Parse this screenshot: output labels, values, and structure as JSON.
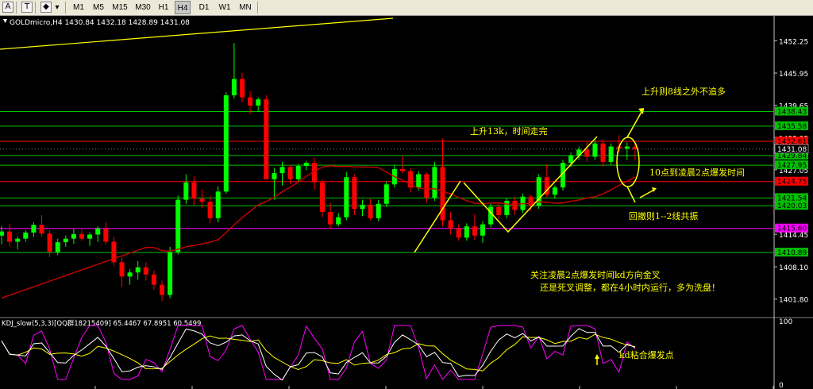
{
  "toolbar": {
    "buttons": [
      "M1",
      "M5",
      "M15",
      "M30",
      "H1",
      "H4",
      "D1",
      "W1",
      "MN"
    ],
    "active": "H4",
    "icons": [
      "cursor-icon",
      "text-icon",
      "shapes-icon"
    ],
    "icon_glyphs": [
      "A",
      "T",
      "◆"
    ]
  },
  "symbol_header": "GOLDmicro,H4  1430.84 1432.18 1428.89 1431.08",
  "indicator_header": "KDJ_slow(5,3,3)[QQ群18215409] 65.4467 67.8951 60.5499",
  "colors": {
    "bull": "#00ff00",
    "bear": "#ff0000",
    "ma": "#cc0000",
    "level_green": "#00c000",
    "level_red": "#ff0000",
    "level_magenta": "#ff00ff",
    "annotation": "#ffff00",
    "k_line": "#ffffff",
    "d_line": "#ffff00",
    "j_line": "#ff00ff"
  },
  "chart_data": {
    "type": "candlestick",
    "symbol": "GOLDmicro",
    "timeframe": "H4",
    "ylim": [
      1398.5,
      1456.5
    ],
    "y_ticks": [
      "1452.25",
      "1445.95",
      "1439.65",
      "1433.35",
      "1427.05",
      "1420.75",
      "1414.45",
      "1408.10",
      "1401.80"
    ],
    "price_levels": [
      {
        "price": 1438.43,
        "label": "1438.43",
        "color": "green"
      },
      {
        "price": 1435.58,
        "label": "1435.58",
        "color": "green"
      },
      {
        "price": 1432.61,
        "label": "1432.61",
        "color": "red"
      },
      {
        "price": 1429.84,
        "label": "1429.84",
        "color": "green"
      },
      {
        "price": 1427.95,
        "label": "1427.95",
        "color": "green"
      },
      {
        "price": 1424.75,
        "label": "1424.75",
        "color": "red"
      },
      {
        "price": 1421.54,
        "label": "1421.54",
        "color": "green"
      },
      {
        "price": 1420.03,
        "label": "1420.03",
        "color": "green"
      },
      {
        "price": 1415.6,
        "label": "1415.60",
        "color": "magenta"
      },
      {
        "price": 1410.89,
        "label": "1410.89",
        "color": "green"
      }
    ],
    "current_price": {
      "price": 1431.08,
      "label": "1431.08"
    },
    "candles": [
      [
        1414.2,
        1416.0,
        1412.5,
        1415.0
      ],
      [
        1415.0,
        1416.5,
        1412.0,
        1413.0
      ],
      [
        1413.0,
        1414.0,
        1411.5,
        1413.6
      ],
      [
        1413.6,
        1415.2,
        1413.0,
        1414.8
      ],
      [
        1414.8,
        1416.8,
        1414.0,
        1416.3
      ],
      [
        1416.3,
        1418.2,
        1414.0,
        1414.6
      ],
      [
        1414.6,
        1415.2,
        1410.0,
        1411.0
      ],
      [
        1411.0,
        1413.6,
        1410.4,
        1412.9
      ],
      [
        1412.9,
        1414.2,
        1412.0,
        1413.6
      ],
      [
        1413.6,
        1415.5,
        1412.6,
        1414.5
      ],
      [
        1414.5,
        1415.4,
        1413.2,
        1413.6
      ],
      [
        1413.6,
        1414.8,
        1412.2,
        1414.4
      ],
      [
        1414.4,
        1416.0,
        1413.0,
        1415.6
      ],
      [
        1415.6,
        1416.8,
        1412.4,
        1413.0
      ],
      [
        1413.0,
        1414.0,
        1408.2,
        1409.0
      ],
      [
        1409.0,
        1410.0,
        1404.2,
        1406.2
      ],
      [
        1406.2,
        1407.6,
        1404.6,
        1407.0
      ],
      [
        1407.0,
        1409.2,
        1405.6,
        1408.0
      ],
      [
        1408.0,
        1409.0,
        1405.4,
        1406.6
      ],
      [
        1406.6,
        1407.4,
        1403.6,
        1404.6
      ],
      [
        1404.6,
        1405.4,
        1401.4,
        1402.6
      ],
      [
        1402.6,
        1412.0,
        1402.0,
        1411.0
      ],
      [
        1411.0,
        1422.0,
        1410.5,
        1421.2
      ],
      [
        1421.2,
        1426.2,
        1420.4,
        1424.6
      ],
      [
        1424.6,
        1425.8,
        1420.2,
        1421.4
      ],
      [
        1421.4,
        1423.2,
        1419.6,
        1420.8
      ],
      [
        1420.8,
        1422.0,
        1416.6,
        1417.6
      ],
      [
        1417.6,
        1423.8,
        1416.8,
        1422.8
      ],
      [
        1422.8,
        1442.2,
        1422.4,
        1441.6
      ],
      [
        1441.6,
        1451.8,
        1441.0,
        1444.8
      ],
      [
        1444.8,
        1446.0,
        1440.2,
        1441.2
      ],
      [
        1441.2,
        1442.4,
        1438.0,
        1439.6
      ],
      [
        1439.6,
        1441.2,
        1438.4,
        1440.8
      ],
      [
        1440.8,
        1441.6,
        1434.6,
        1425.2
      ],
      [
        1425.2,
        1427.4,
        1421.2,
        1426.4
      ],
      [
        1426.4,
        1428.6,
        1424.0,
        1427.6
      ],
      [
        1427.6,
        1428.0,
        1424.2,
        1425.2
      ],
      [
        1425.2,
        1428.2,
        1424.6,
        1427.8
      ],
      [
        1427.8,
        1428.8,
        1427.0,
        1428.4
      ],
      [
        1428.4,
        1429.4,
        1423.2,
        1424.6
      ],
      [
        1424.6,
        1425.2,
        1417.8,
        1418.8
      ],
      [
        1418.8,
        1420.6,
        1415.6,
        1416.4
      ],
      [
        1416.4,
        1418.6,
        1416.0,
        1417.8
      ],
      [
        1417.8,
        1426.6,
        1417.2,
        1425.6
      ],
      [
        1425.6,
        1426.2,
        1418.2,
        1419.4
      ],
      [
        1419.4,
        1421.2,
        1418.0,
        1420.2
      ],
      [
        1420.2,
        1421.4,
        1417.2,
        1417.6
      ],
      [
        1417.6,
        1421.2,
        1417.0,
        1420.4
      ],
      [
        1420.4,
        1424.8,
        1419.8,
        1424.2
      ],
      [
        1424.2,
        1428.0,
        1423.6,
        1427.2
      ],
      [
        1427.2,
        1429.8,
        1426.4,
        1426.8
      ],
      [
        1426.8,
        1427.4,
        1422.6,
        1423.6
      ],
      [
        1423.6,
        1426.8,
        1423.0,
        1426.2
      ],
      [
        1426.2,
        1426.6,
        1420.6,
        1421.6
      ],
      [
        1421.6,
        1428.6,
        1421.0,
        1427.6
      ],
      [
        1427.6,
        1433.2,
        1416.0,
        1417.2
      ],
      [
        1417.2,
        1418.8,
        1414.4,
        1415.6
      ],
      [
        1415.6,
        1416.4,
        1413.2,
        1413.8
      ],
      [
        1413.8,
        1416.6,
        1413.2,
        1416.0
      ],
      [
        1416.0,
        1418.4,
        1413.4,
        1414.2
      ],
      [
        1414.2,
        1417.0,
        1412.8,
        1416.4
      ],
      [
        1416.4,
        1420.4,
        1415.8,
        1419.8
      ],
      [
        1419.8,
        1420.8,
        1417.4,
        1418.2
      ],
      [
        1418.2,
        1421.6,
        1417.6,
        1421.0
      ],
      [
        1421.0,
        1421.8,
        1418.2,
        1419.2
      ],
      [
        1419.2,
        1422.4,
        1418.6,
        1421.8
      ],
      [
        1421.8,
        1422.2,
        1419.0,
        1420.0
      ],
      [
        1420.0,
        1426.2,
        1419.4,
        1425.6
      ],
      [
        1425.6,
        1428.2,
        1421.6,
        1422.2
      ],
      [
        1422.2,
        1424.0,
        1421.4,
        1423.6
      ],
      [
        1423.6,
        1429.0,
        1423.0,
        1428.4
      ],
      [
        1428.4,
        1430.4,
        1427.6,
        1429.8
      ],
      [
        1429.8,
        1431.6,
        1429.0,
        1431.0
      ],
      [
        1431.0,
        1432.6,
        1428.6,
        1429.6
      ],
      [
        1429.6,
        1432.8,
        1429.0,
        1432.2
      ],
      [
        1432.2,
        1433.0,
        1427.6,
        1428.6
      ],
      [
        1428.6,
        1432.2,
        1428.0,
        1431.6
      ],
      [
        1431.6,
        1433.8,
        1430.4,
        1431.2
      ],
      [
        1431.2,
        1432.4,
        1429.0,
        1431.6
      ],
      [
        1431.6,
        1432.2,
        1428.9,
        1431.08
      ]
    ],
    "annotations": [
      "上升则8线之外不追多",
      "上升13k，时间走完",
      "10点到凌晨2点爆发时间",
      "回撤则1--2线共振",
      "关注凌晨2点爆发时间kd方向金叉",
      "还是死叉调整，都在4小时内运行，多为洗盘！"
    ],
    "indicator": {
      "name": "KDJ_slow(5,3,3)",
      "ylim": [
        0,
        100
      ],
      "y_ticks": [
        "100",
        "0"
      ],
      "values": {
        "k": 65.4467,
        "d": 67.8951,
        "j": 60.5499
      },
      "annotation": "kd粘合爆发点"
    }
  }
}
